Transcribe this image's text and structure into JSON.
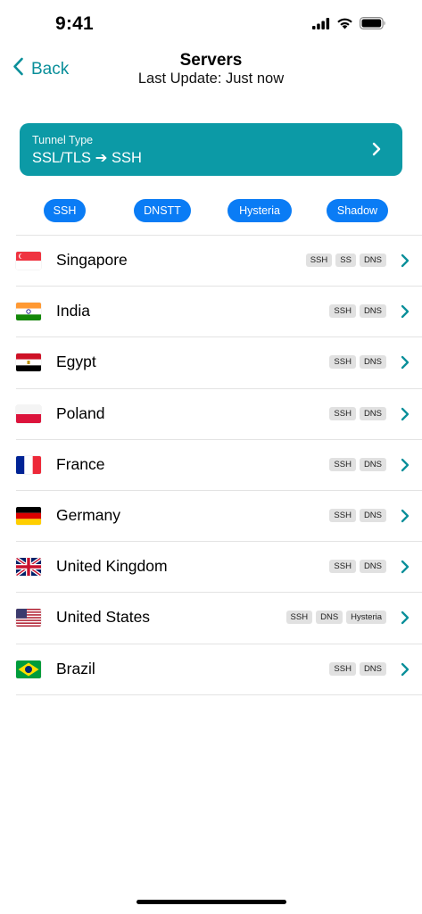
{
  "status_bar": {
    "time": "9:41"
  },
  "nav": {
    "back_label": "Back",
    "title": "Servers",
    "subtitle": "Last Update: Just now"
  },
  "tunnel": {
    "label": "Tunnel Type",
    "value": "SSL/TLS ➔ SSH"
  },
  "filters": [
    {
      "label": "SSH"
    },
    {
      "label": "DNSTT"
    },
    {
      "label": "Hysteria"
    },
    {
      "label": "Shadow"
    }
  ],
  "servers": [
    {
      "country": "Singapore",
      "flag": "sg-flag-icon",
      "tags": [
        "SSH",
        "SS",
        "DNS"
      ]
    },
    {
      "country": "India",
      "flag": "in-flag-icon",
      "tags": [
        "SSH",
        "DNS"
      ]
    },
    {
      "country": "Egypt",
      "flag": "eg-flag-icon",
      "tags": [
        "SSH",
        "DNS"
      ]
    },
    {
      "country": "Poland",
      "flag": "pl-flag-icon",
      "tags": [
        "SSH",
        "DNS"
      ]
    },
    {
      "country": "France",
      "flag": "fr-flag-icon",
      "tags": [
        "SSH",
        "DNS"
      ]
    },
    {
      "country": "Germany",
      "flag": "de-flag-icon",
      "tags": [
        "SSH",
        "DNS"
      ]
    },
    {
      "country": "United Kingdom",
      "flag": "gb-flag-icon",
      "tags": [
        "SSH",
        "DNS"
      ]
    },
    {
      "country": "United States",
      "flag": "us-flag-icon",
      "tags": [
        "SSH",
        "DNS",
        "Hysteria"
      ]
    },
    {
      "country": "Brazil",
      "flag": "br-flag-icon",
      "tags": [
        "SSH",
        "DNS"
      ]
    }
  ],
  "colors": {
    "accent": "#0a8f9a",
    "card": "#0c9aa6",
    "pill": "#0a7cf5",
    "tag": "#e1e1e1"
  }
}
